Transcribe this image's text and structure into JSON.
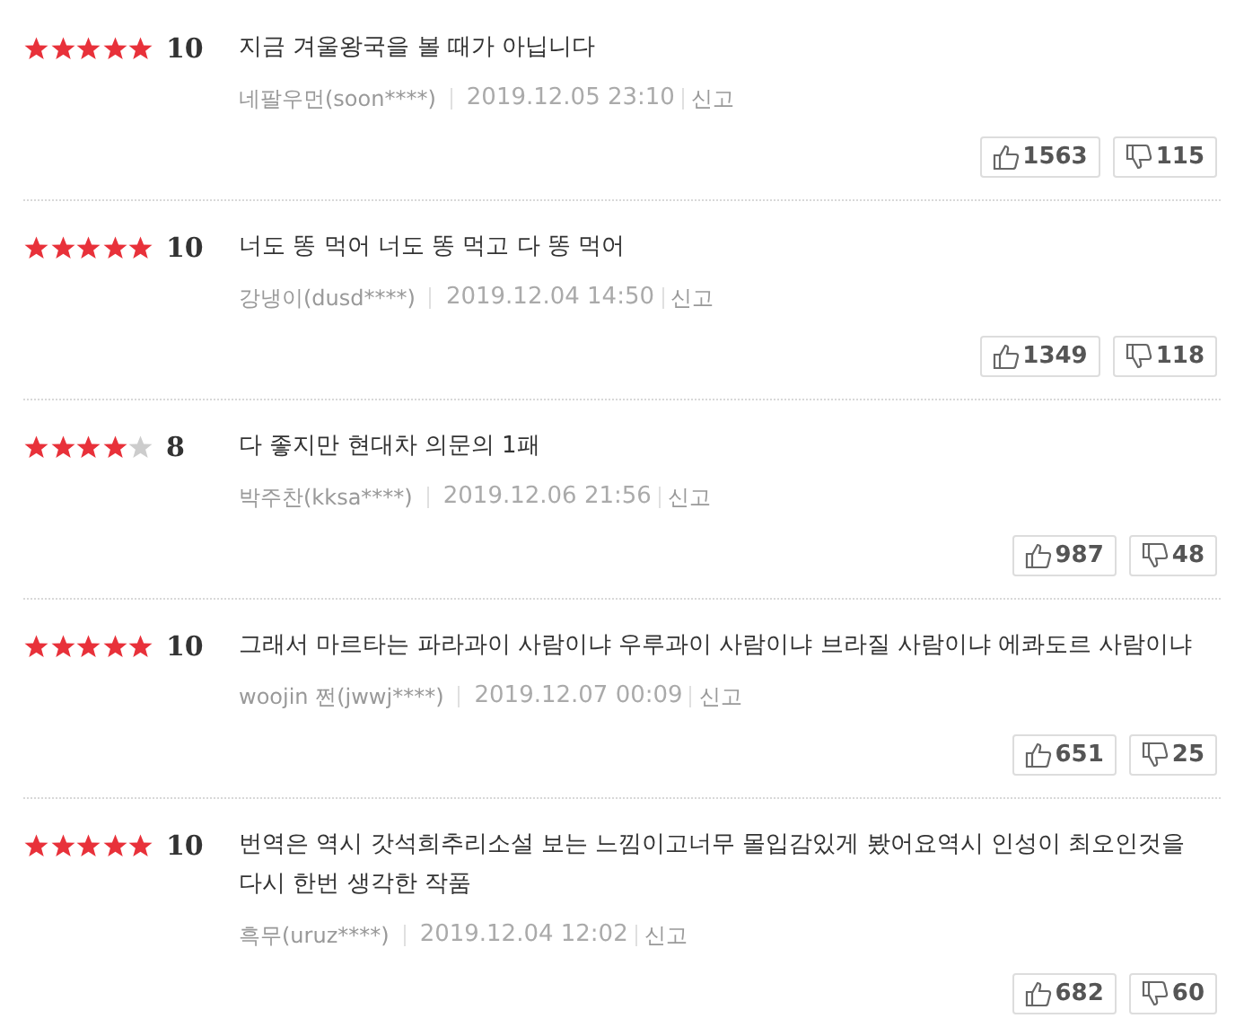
{
  "reviews": [
    {
      "stars": 5,
      "score": "10",
      "comment": "지금 겨울왕국을 볼 때가 아닙니다",
      "author": "네팔우먼(soon****)",
      "date": "2019.12.05 23:10",
      "report": "신고",
      "likes": "1563",
      "dislikes": "115"
    },
    {
      "stars": 5,
      "score": "10",
      "comment": "너도 똥 먹어 너도 똥 먹고 다 똥 먹어",
      "author": "강냉이(dusd****)",
      "date": "2019.12.04 14:50",
      "report": "신고",
      "likes": "1349",
      "dislikes": "118"
    },
    {
      "stars": 4,
      "score": "8",
      "comment": "다 좋지만 현대차 의문의 1패",
      "author": "박주찬(kksa****)",
      "date": "2019.12.06 21:56",
      "report": "신고",
      "likes": "987",
      "dislikes": "48"
    },
    {
      "stars": 5,
      "score": "10",
      "comment": "그래서 마르타는 파라과이 사람이냐 우루과이 사람이냐 브라질 사람이냐 에콰도르 사람이냐",
      "author": "woojin 쩐(jwwj****)",
      "date": "2019.12.07 00:09",
      "report": "신고",
      "likes": "651",
      "dislikes": "25"
    },
    {
      "stars": 5,
      "score": "10",
      "comment": "번역은 역시 갓석희추리소설 보는 느낌이고너무 몰입감있게 봤어요역시 인성이 최오인것을 다시 한번 생각한 작품",
      "author": "흑무(uruz****)",
      "date": "2019.12.04 12:02",
      "report": "신고",
      "likes": "682",
      "dislikes": "60"
    }
  ]
}
